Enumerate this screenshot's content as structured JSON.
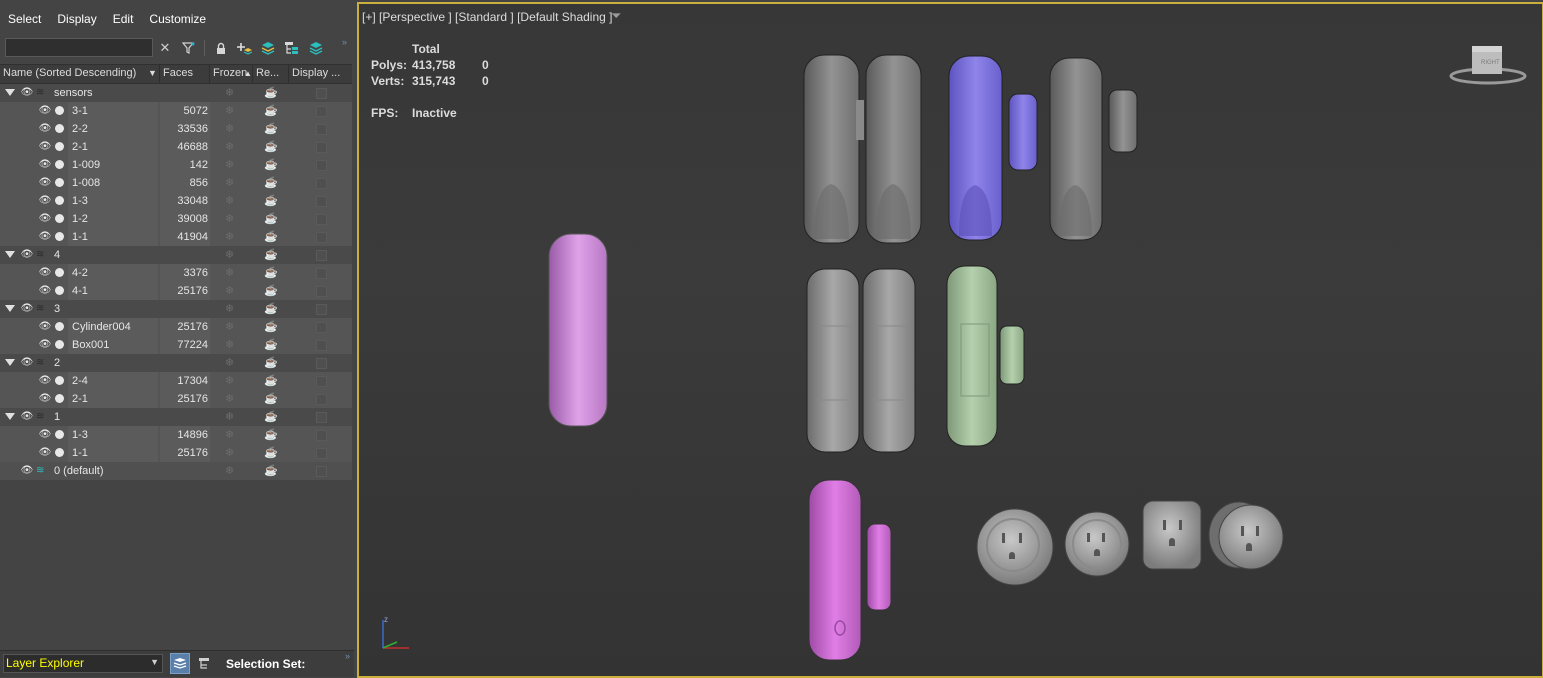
{
  "menu": [
    "Select",
    "Display",
    "Edit",
    "Customize"
  ],
  "columns": {
    "name": "Name (Sorted Descending)",
    "faces": "Faces",
    "frozen": "Frozen",
    "render": "Re...",
    "display": "Display ..."
  },
  "tree": [
    {
      "type": "layer",
      "name": "sensors"
    },
    {
      "type": "obj",
      "name": "3-1",
      "faces": "5072"
    },
    {
      "type": "obj",
      "name": "2-2",
      "faces": "33536"
    },
    {
      "type": "obj",
      "name": "2-1",
      "faces": "46688"
    },
    {
      "type": "obj",
      "name": "1-009",
      "faces": "142"
    },
    {
      "type": "obj",
      "name": "1-008",
      "faces": "856"
    },
    {
      "type": "obj",
      "name": "1-3",
      "faces": "33048"
    },
    {
      "type": "obj",
      "name": "1-2",
      "faces": "39008"
    },
    {
      "type": "obj",
      "name": "1-1",
      "faces": "41904"
    },
    {
      "type": "layer",
      "name": "4"
    },
    {
      "type": "obj",
      "name": "4-2",
      "faces": "3376"
    },
    {
      "type": "obj",
      "name": "4-1",
      "faces": "25176"
    },
    {
      "type": "layer",
      "name": "3"
    },
    {
      "type": "obj",
      "name": "Cylinder004",
      "faces": "25176"
    },
    {
      "type": "obj",
      "name": "Box001",
      "faces": "77224"
    },
    {
      "type": "layer",
      "name": "2"
    },
    {
      "type": "obj",
      "name": "2-4",
      "faces": "17304"
    },
    {
      "type": "obj",
      "name": "2-1",
      "faces": "25176"
    },
    {
      "type": "layer",
      "name": "1"
    },
    {
      "type": "obj",
      "name": "1-3",
      "faces": "14896"
    },
    {
      "type": "obj",
      "name": "1-1",
      "faces": "25176"
    },
    {
      "type": "default",
      "name": "0 (default)"
    }
  ],
  "bottom": {
    "explorer": "Layer Explorer",
    "selection_set": "Selection Set:"
  },
  "viewport": {
    "label": "[+] [Perspective ] [Standard ] [Default Shading ]",
    "stats": {
      "total_label": "Total",
      "polys_label": "Polys:",
      "polys_total": "413,758",
      "polys_sel": "0",
      "verts_label": "Verts:",
      "verts_total": "315,743",
      "verts_sel": "0",
      "fps_label": "FPS:",
      "fps_value": "Inactive"
    },
    "viewcube_label": "RIGHT",
    "axis_label": "z"
  },
  "colors": {
    "viewport_border": "#c9b03e",
    "explorer_text": "#ffff00",
    "pink": "#d98ae0",
    "blue": "#8a7fe0",
    "green": "#a9c6a3",
    "gray": "#8e8e8e"
  }
}
